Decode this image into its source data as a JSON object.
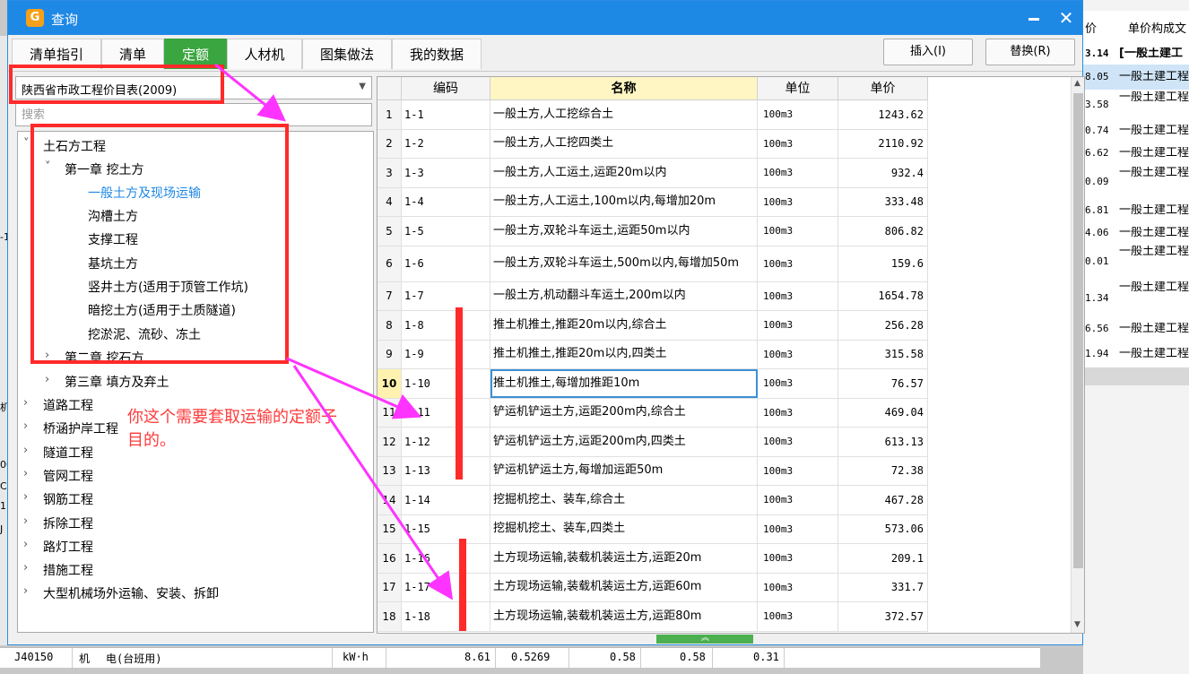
{
  "dialog": {
    "title": "查询",
    "app_icon_glyph": "G",
    "close_glyph": "✕"
  },
  "tabs": [
    "清单指引",
    "清单",
    "定额",
    "人材机",
    "图集做法",
    "我的数据"
  ],
  "active_tab": "定额",
  "toolbar": {
    "insert_label": "插入(I)",
    "replace_label": "替换(R)"
  },
  "library": {
    "selected": "陕西省市政工程价目表(2009)",
    "dropdown_glyph": "▼"
  },
  "search": {
    "placeholder": "搜索"
  },
  "tree": {
    "root": "土石方工程",
    "chapter1": "第一章 挖土方",
    "chapter1_items": [
      "一般土方及现场运输",
      "沟槽土方",
      "支撑工程",
      "基坑土方",
      "竖井土方(适用于顶管工作坑)",
      "暗挖土方(适用于土质隧道)",
      "挖淤泥、流砂、冻土"
    ],
    "chapter2": "第二章 挖石方",
    "chapter3": "第三章 填方及弃土",
    "categories": [
      "道路工程",
      "桥涵护岸工程",
      "隧道工程",
      "管网工程",
      "钢筋工程",
      "拆除工程",
      "路灯工程",
      "措施工程",
      "大型机械场外运输、安装、拆卸"
    ],
    "expand_glyph": "˅",
    "collapse_glyph": "›"
  },
  "grid": {
    "columns": [
      "编码",
      "名称",
      "单位",
      "单价"
    ],
    "current_row": "10",
    "rows": [
      {
        "n": "1",
        "code": "1-1",
        "name": "一般土方,人工挖综合土",
        "unit": "100m3",
        "price": "1243.62"
      },
      {
        "n": "2",
        "code": "1-2",
        "name": "一般土方,人工挖四类土",
        "unit": "100m3",
        "price": "2110.92"
      },
      {
        "n": "3",
        "code": "1-3",
        "name": "一般土方,人工运土,运距20m以内",
        "unit": "100m3",
        "price": "932.4"
      },
      {
        "n": "4",
        "code": "1-4",
        "name": "一般土方,人工运土,100m以内,每增加20m",
        "unit": "100m3",
        "price": "333.48"
      },
      {
        "n": "5",
        "code": "1-5",
        "name": "一般土方,双轮斗车运土,运距50m以内",
        "unit": "100m3",
        "price": "806.82"
      },
      {
        "n": "6",
        "code": "1-6",
        "name": "一般土方,双轮斗车运土,500m以内,每增加50m",
        "unit": "100m3",
        "price": "159.6"
      },
      {
        "n": "7",
        "code": "1-7",
        "name": "一般土方,机动翻斗车运土,200m以内",
        "unit": "100m3",
        "price": "1654.78"
      },
      {
        "n": "8",
        "code": "1-8",
        "name": "推土机推土,推距20m以内,综合土",
        "unit": "100m3",
        "price": "256.28"
      },
      {
        "n": "9",
        "code": "1-9",
        "name": "推土机推土,推距20m以内,四类土",
        "unit": "100m3",
        "price": "315.58"
      },
      {
        "n": "10",
        "code": "1-10",
        "name": "推土机推土,每增加推距10m",
        "unit": "100m3",
        "price": "76.57"
      },
      {
        "n": "11",
        "code": "1-11",
        "name": "铲运机铲运土方,运距200m内,综合土",
        "unit": "100m3",
        "price": "469.04"
      },
      {
        "n": "12",
        "code": "1-12",
        "name": "铲运机铲运土方,运距200m内,四类土",
        "unit": "100m3",
        "price": "613.13"
      },
      {
        "n": "13",
        "code": "1-13",
        "name": "铲运机铲运土方,每增加运距50m",
        "unit": "100m3",
        "price": "72.38"
      },
      {
        "n": "14",
        "code": "1-14",
        "name": "挖掘机挖土、装车,综合土",
        "unit": "100m3",
        "price": "467.28"
      },
      {
        "n": "15",
        "code": "1-15",
        "name": "挖掘机挖土、装车,四类土",
        "unit": "100m3",
        "price": "573.06"
      },
      {
        "n": "16",
        "code": "1-16",
        "name": "土方现场运输,装载机装运土方,运距20m",
        "unit": "100m3",
        "price": "209.1"
      },
      {
        "n": "17",
        "code": "1-17",
        "name": "土方现场运输,装载机装运土方,运距60m",
        "unit": "100m3",
        "price": "331.7"
      },
      {
        "n": "18",
        "code": "1-18",
        "name": "土方现场运输,装载机装运土方,运距80m",
        "unit": "100m3",
        "price": "372.57"
      }
    ]
  },
  "annotation": {
    "note": "你这个需要套取运输的定额子目的。",
    "color": "#ff3b3b"
  },
  "background_right": {
    "headers": [
      "价",
      "单价构成文"
    ],
    "rows": [
      {
        "v": "3.14",
        "t": "[一般土建工"
      },
      {
        "v": "8.05",
        "t": "一般土建工程"
      },
      {
        "v": "3.58",
        "t": "一般土建工程 工调整计入表"
      },
      {
        "v": "0.74",
        "t": "一般土建工程"
      },
      {
        "v": "6.62",
        "t": "一般土建工程"
      },
      {
        "v": "0.09",
        "t": "一般土建工程 工调整计入表"
      },
      {
        "v": "6.81",
        "t": "一般土建工程"
      },
      {
        "v": "4.06",
        "t": "一般土建工程"
      },
      {
        "v": "0.01",
        "t": "一般土建工程 工调整计入表"
      },
      {
        "v": "1.34",
        "t": "一般土建工程 工调整计入表"
      },
      {
        "v": "6.56",
        "t": "一般土建工程"
      },
      {
        "v": "1.94",
        "t": "一般土建工程 工调整计入表"
      }
    ]
  },
  "background_left": [
    "-1",
    "机",
    "00",
    "C",
    "11",
    "J"
  ],
  "bottom_row": [
    "J40150",
    "机",
    "电(台班用)",
    "kW·h",
    "8.61",
    "0.5269",
    "0.58",
    "0.58",
    "0.31"
  ],
  "colors": {
    "titlebar": "#1e88e5",
    "active_tab": "#3aa63f",
    "annotation_red": "#ff2a2a",
    "arrow_magenta": "#ff33ff",
    "tree_selected": "#1e88e5"
  }
}
